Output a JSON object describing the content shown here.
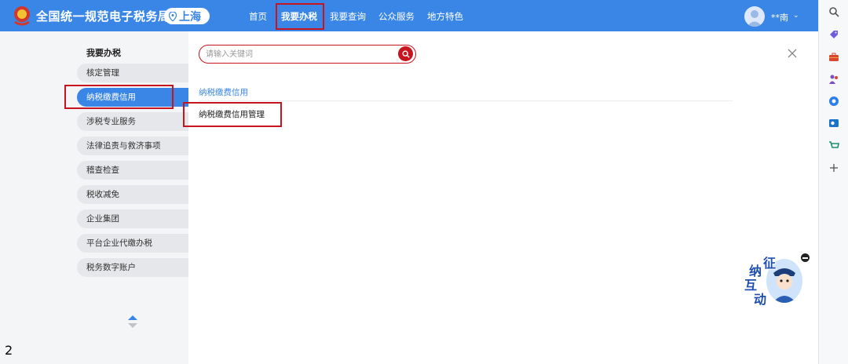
{
  "header": {
    "brand": "全国统一规范电子税务局",
    "region": "上海",
    "nav": [
      "首页",
      "我要办税",
      "我要查询",
      "公众服务",
      "地方特色"
    ],
    "user_name": "**南",
    "accent_color": "#3a86e6"
  },
  "left_nav": {
    "heading": "我要办税",
    "items": [
      "核定管理",
      "纳税缴费信用",
      "涉税专业服务",
      "法律追责与救济事项",
      "稽查检查",
      "税收减免",
      "企业集团",
      "平台企业代缴办税",
      "税务数字账户"
    ],
    "selected_index": 1
  },
  "main": {
    "search_placeholder": "请输入关键词",
    "section_title": "纳税缴费信用",
    "links": [
      "纳税缴费信用管理"
    ]
  },
  "assistant": {
    "chars": [
      "征",
      "纳",
      "互",
      "动"
    ]
  },
  "page_number": "2",
  "icons": [
    "search-icon",
    "tag-icon",
    "briefcase-icon",
    "people-icon",
    "office-icon",
    "outlook-icon",
    "cart-icon",
    "plus-icon"
  ],
  "highlight_color": "#c8141e"
}
